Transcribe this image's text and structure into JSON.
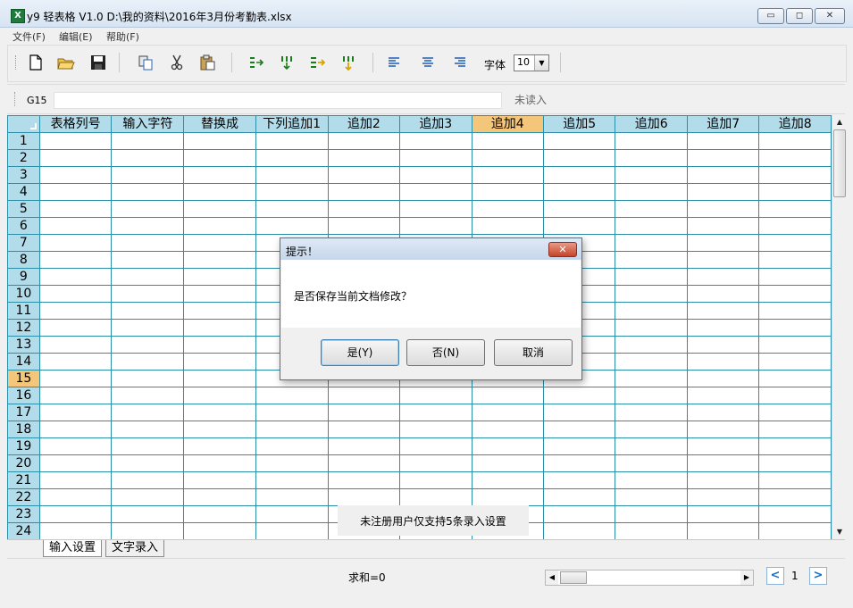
{
  "window": {
    "title": "y9 轻表格 V1.0    D:\\我的资料\\2016年3月份考勤表.xlsx",
    "minimize": "▭",
    "maximize": "◻",
    "close": "✕"
  },
  "menu": [
    "文件(F)",
    "编辑(E)",
    "帮助(F)"
  ],
  "toolbar": {
    "buttons": [
      "new-file-icon",
      "open-folder-icon",
      "save-icon",
      "copy-icon",
      "cut-icon",
      "paste-icon",
      "insert-row-icon",
      "insert-column-icon",
      "append-row-icon",
      "append-column-icon",
      "align-left-icon",
      "align-center-icon",
      "align-right-icon"
    ],
    "font_label": "字体",
    "font_size": "10"
  },
  "formula_bar": {
    "cell_ref": "G15",
    "value": "",
    "status": "未读入"
  },
  "grid": {
    "columns": [
      "表格列号",
      "输入字符",
      "替换成",
      "下列追加1",
      "追加2",
      "追加3",
      "追加4",
      "追加5",
      "追加6",
      "追加7",
      "追加8"
    ],
    "highlight_column": "追加4",
    "rows": [
      "1",
      "2",
      "3",
      "4",
      "5",
      "6",
      "7",
      "8",
      "9",
      "10",
      "11",
      "12",
      "13",
      "14",
      "15",
      "16",
      "17",
      "18",
      "19",
      "20",
      "21",
      "22",
      "23",
      "24"
    ],
    "highlight_row": "15"
  },
  "notice": "未注册用户仅支持5条录入设置",
  "sheet_tabs": [
    "输入设置",
    "文字录入"
  ],
  "status": {
    "sum": "求和=0",
    "page": "1",
    "prev": "<",
    "next": ">"
  },
  "dialog": {
    "title": "提示！",
    "message": "是否保存当前文档修改？",
    "buttons": {
      "yes": "是(Y)",
      "no": "否(N)",
      "cancel": "取消"
    },
    "close": "✕"
  },
  "colors": {
    "header_bg": "#b3dcea",
    "highlight": "#f4c67a",
    "grid_line": "#2b8fa8"
  }
}
